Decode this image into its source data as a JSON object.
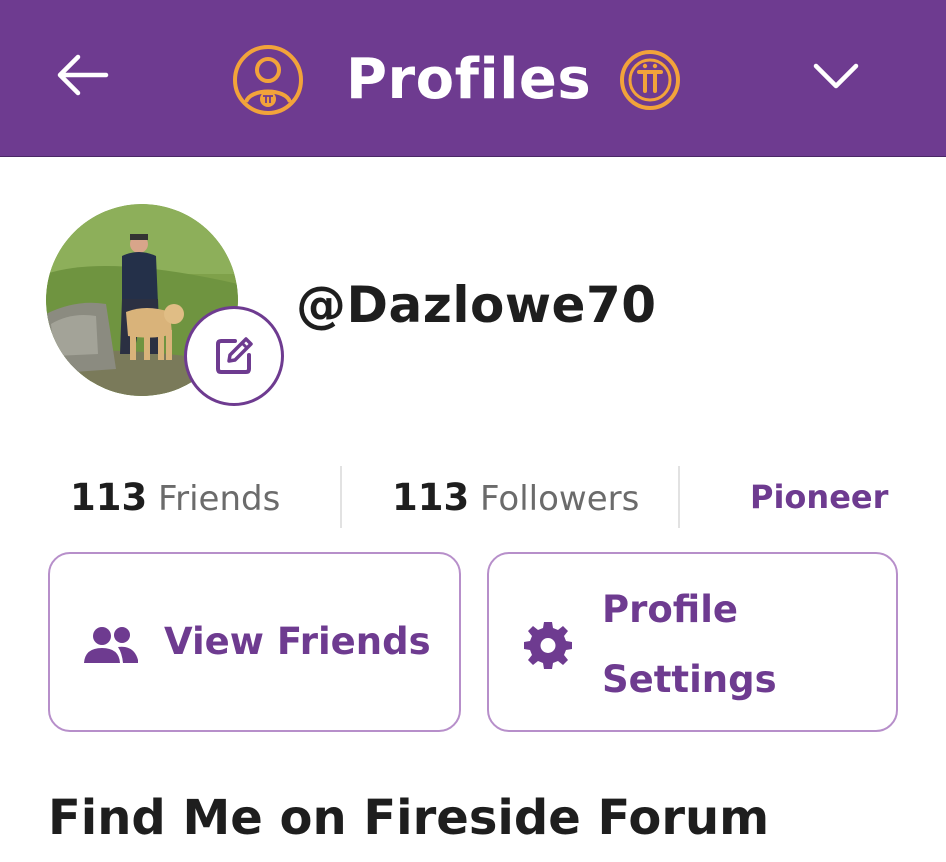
{
  "header": {
    "title": "Profiles",
    "back_icon": "arrow-left-icon",
    "profile_icon": "pi-user-icon",
    "pi_icon": "pi-coin-icon",
    "menu_icon": "chevron-down-icon",
    "background": "#6e3b90",
    "accent": "#f2a33a"
  },
  "profile": {
    "username": "@Dazlowe70",
    "edit_icon": "edit-icon"
  },
  "stats": {
    "friends_count": "113",
    "friends_label": "Friends",
    "followers_count": "113",
    "followers_label": "Followers",
    "role": "Pioneer"
  },
  "actions": {
    "view_friends_label": "View Friends",
    "view_friends_icon": "people-icon",
    "settings_label_line1": "Profile",
    "settings_label_line2": "Settings",
    "settings_icon": "gear-icon"
  },
  "section": {
    "title": "Find Me on Fireside Forum"
  }
}
